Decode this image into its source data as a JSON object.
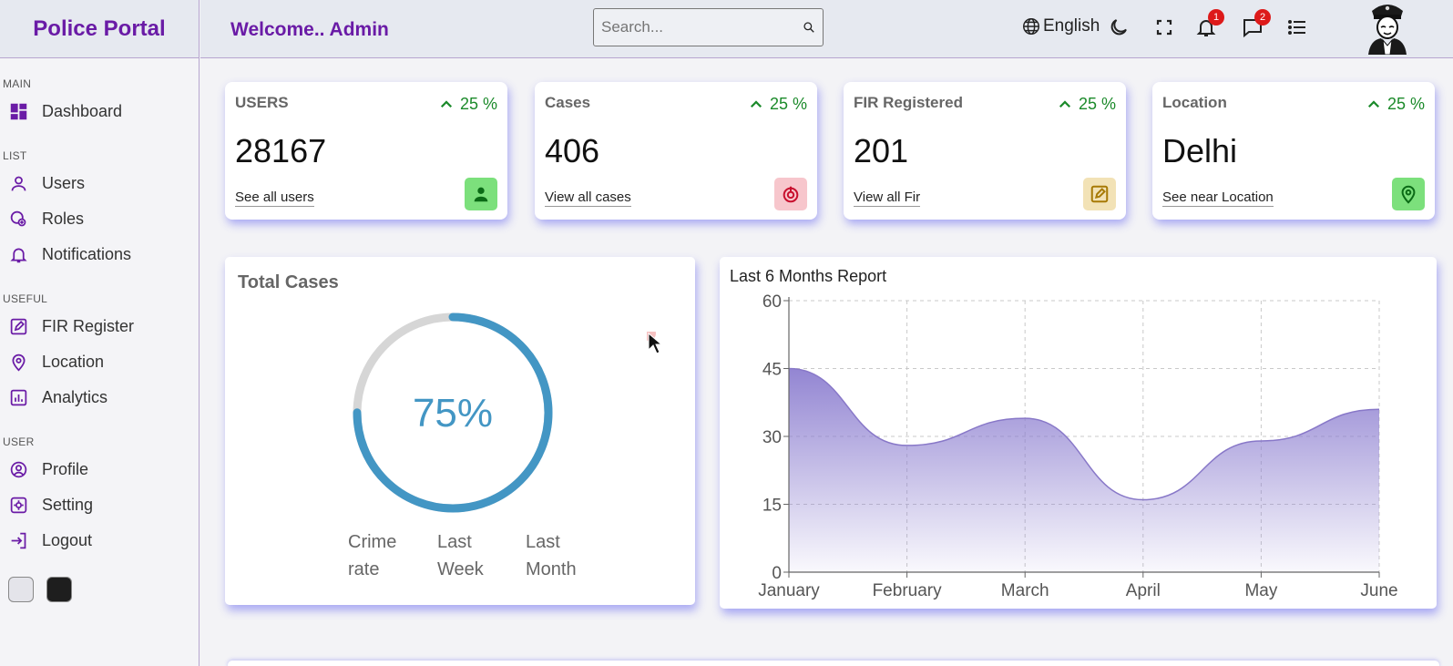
{
  "app": {
    "title": "Police Portal",
    "welcome": "Welcome.. Admin"
  },
  "search": {
    "placeholder": "Search..."
  },
  "header": {
    "language": "English",
    "notifications_count": "1",
    "messages_count": "2"
  },
  "sidebar": {
    "sections": [
      {
        "title": "MAIN",
        "items": [
          {
            "label": "Dashboard",
            "icon": "dashboard-icon"
          }
        ]
      },
      {
        "title": "LIST",
        "items": [
          {
            "label": "Users",
            "icon": "user-icon"
          },
          {
            "label": "Roles",
            "icon": "roles-icon"
          },
          {
            "label": "Notifications",
            "icon": "bell-icon"
          }
        ]
      },
      {
        "title": "USEFUL",
        "items": [
          {
            "label": "FIR Register",
            "icon": "edit-icon"
          },
          {
            "label": "Location",
            "icon": "location-pin-icon"
          },
          {
            "label": "Analytics",
            "icon": "analytics-icon"
          }
        ]
      },
      {
        "title": "USER",
        "items": [
          {
            "label": "Profile",
            "icon": "profile-icon"
          },
          {
            "label": "Setting",
            "icon": "settings-icon"
          },
          {
            "label": "Logout",
            "icon": "logout-icon"
          }
        ]
      }
    ],
    "theme_colors": {
      "light": "#e4e4ea",
      "dark": "#1e1e1e"
    }
  },
  "cards": [
    {
      "title": "USERS",
      "percent": "25 %",
      "value": "28167",
      "link": "See all users",
      "icon": "user-icon",
      "icon_bg": "#7ce07c",
      "icon_color": "#0b6b16"
    },
    {
      "title": "Cases",
      "percent": "25 %",
      "value": "406",
      "link": "View all cases",
      "icon": "target-icon",
      "icon_bg": "#f7c6cc",
      "icon_color": "#c8102e"
    },
    {
      "title": "FIR Registered",
      "percent": "25 %",
      "value": "201",
      "link": "View all Fir",
      "icon": "edit-icon",
      "icon_bg": "#f2e2b6",
      "icon_color": "#a77a06"
    },
    {
      "title": "Location",
      "percent": "25 %",
      "value": "Delhi",
      "link": "See near Location",
      "icon": "location-pin-icon",
      "icon_bg": "#7ce07c",
      "icon_color": "#0b6b16"
    }
  ],
  "total_cases": {
    "title": "Total Cases",
    "percent_label": "75%",
    "progress": 0.75,
    "progress_color": "#4396c4",
    "track_color": "#d6d6d6",
    "legend": [
      {
        "line1": "Crime",
        "line2": "rate"
      },
      {
        "line1": "Last",
        "line2": "Week"
      },
      {
        "line1": "Last",
        "line2": "Month"
      }
    ]
  },
  "report": {
    "title": "Last 6 Months Report",
    "chart_data": {
      "type": "area",
      "title": "Last 6 Months Report",
      "categories": [
        "January",
        "February",
        "March",
        "April",
        "May",
        "June"
      ],
      "series": [
        {
          "values": [
            45,
            28,
            34,
            16,
            29,
            36
          ]
        }
      ],
      "ylim": [
        0,
        60
      ],
      "yticks": [
        0,
        15,
        30,
        45,
        60
      ],
      "grid": true,
      "fill_color": "#8d7fd0",
      "line_color": "#8878c8"
    }
  }
}
